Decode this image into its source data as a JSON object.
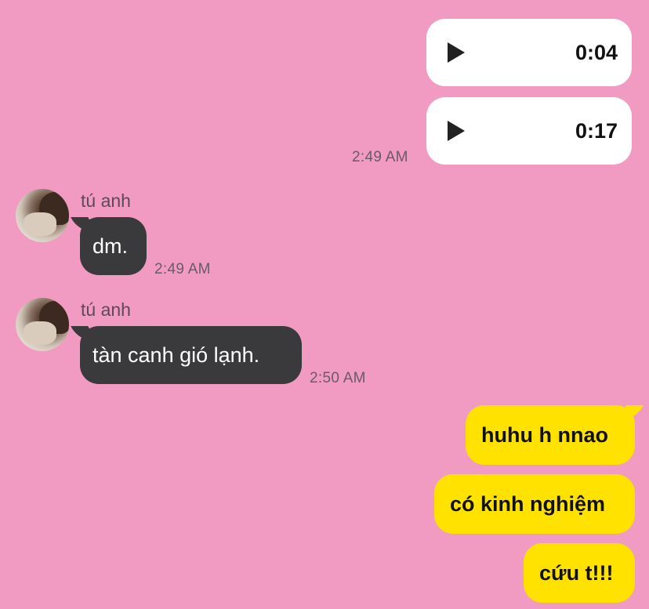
{
  "colors": {
    "background": "#f29bc2",
    "incoming_bubble": "#3a3a3d",
    "outgoing_bubble": "#ffe200",
    "voice_bubble": "#ffffff"
  },
  "voice_messages": [
    {
      "duration": "0:04",
      "icon": "play-icon"
    },
    {
      "duration": "0:17",
      "icon": "play-icon"
    }
  ],
  "voice_timestamp": "2:49 AM",
  "incoming_messages": [
    {
      "sender": "tú anh",
      "text": "dm.",
      "time": "2:49 AM"
    },
    {
      "sender": "tú anh",
      "text": "tàn canh gió lạnh.",
      "time": "2:50 AM"
    }
  ],
  "outgoing_messages": [
    {
      "text": "huhu h nnao"
    },
    {
      "text": "có kinh nghiệm"
    },
    {
      "text": "cứu t!!!"
    }
  ]
}
